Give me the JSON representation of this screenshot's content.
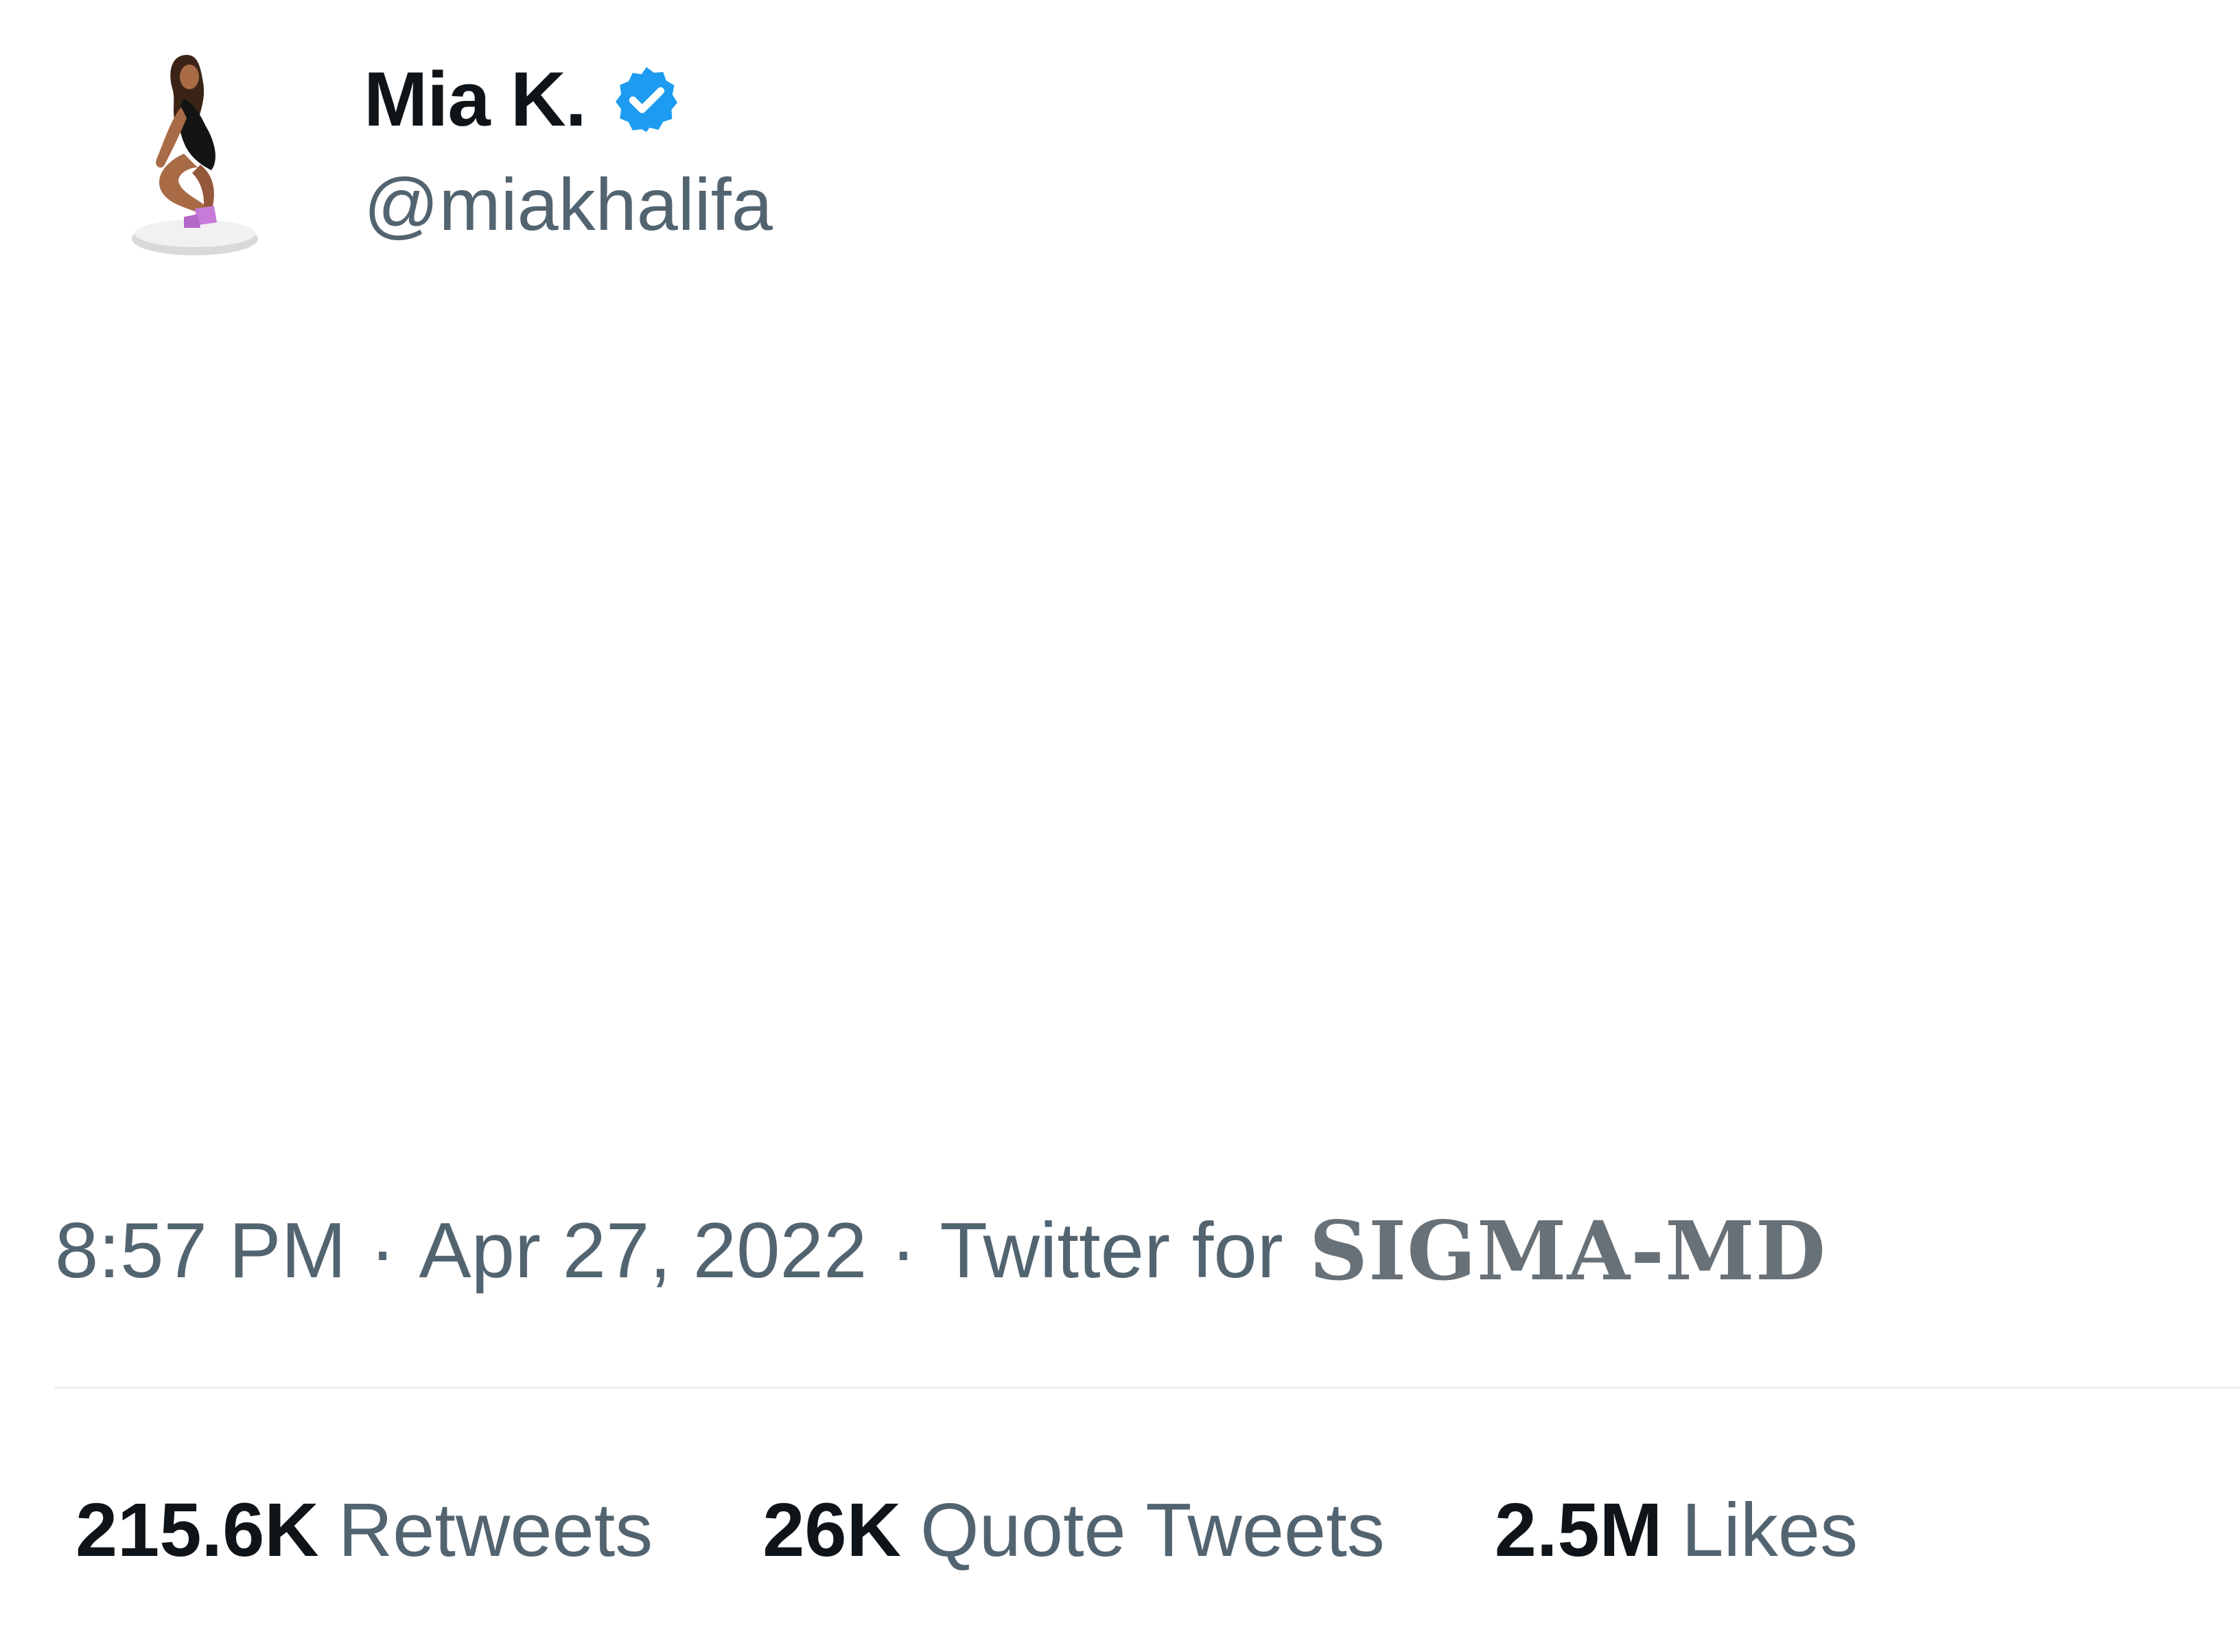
{
  "tweet": {
    "author": {
      "display_name": "Mia K.",
      "handle": "@miakhalifa",
      "verified": true,
      "avatar_icon": "avatar-cartoon-woman-icon",
      "verified_color": "#1d9bf0"
    },
    "meta": {
      "time": "8:57 PM",
      "separator": "·",
      "date": "Apr 27, 2022",
      "source_prefix": "Twitter for",
      "source_app": "SIGMA-MD"
    },
    "stats": [
      {
        "count": "215.6K",
        "label": "Retweets"
      },
      {
        "count": "26K",
        "label": "Quote Tweets"
      },
      {
        "count": "2.5M",
        "label": "Likes"
      }
    ]
  },
  "colors": {
    "text_primary": "#0f1419",
    "text_secondary": "#536471",
    "divider": "#eff3f4",
    "background": "#ffffff"
  }
}
